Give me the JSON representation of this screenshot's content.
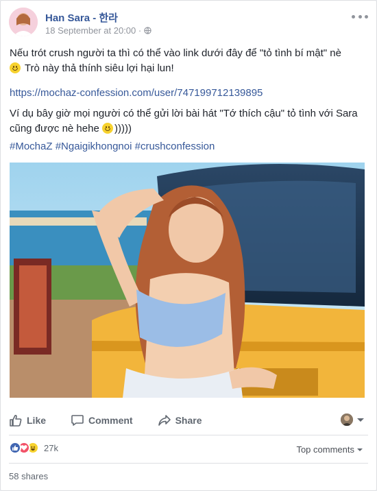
{
  "post": {
    "author": "Han Sara - 한라",
    "timestamp": "18 September at 20:00 ·",
    "privacy_icon": "globe-icon",
    "paragraph1_a": "Nếu trót crush người ta thì có thể vào link dưới đây để \"tỏ tình bí mật\" nè",
    "paragraph1_b": " Trò này thả thính siêu lợi hại lun!",
    "link": "https://mochaz-confession.com/user/747199712139895",
    "paragraph2_a": "Ví dụ bây giờ mọi người có thể gửi lời bài hát \"Tớ thích cậu\" tỏ tình với Sara cũng được nè hehe",
    "paragraph2_b": ")))))",
    "hashtags": "#MochaZ #Ngaigikhongnoi #crushconfession"
  },
  "actions": {
    "like": "Like",
    "comment": "Comment",
    "share": "Share"
  },
  "stats": {
    "reaction_count": "27k",
    "top_comments": "Top comments",
    "shares": "58 shares"
  },
  "colors": {
    "link": "#365899",
    "like_blue": "#4267b2",
    "love_red": "#f25268",
    "haha_yellow": "#f7d22e"
  }
}
